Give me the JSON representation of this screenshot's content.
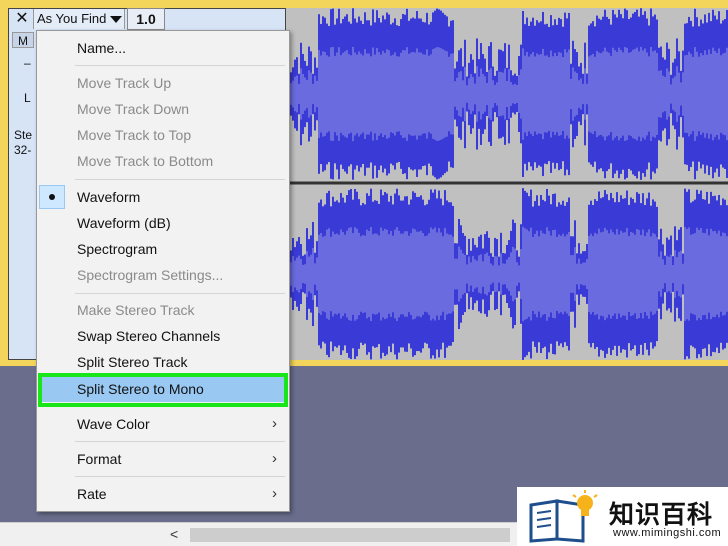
{
  "track": {
    "close_glyph": "✕",
    "name": "As You Find",
    "zoom": "1.0",
    "mute_stub": "M",
    "gain_stub": "–",
    "pan_stub": "L",
    "info_line1": "Ste",
    "info_line2": "32-",
    "waveform_color": "#3a3ad6",
    "waveform_light_color": "#6b6be0",
    "waveform_bg": "#c0c0c0"
  },
  "menu": {
    "items": [
      {
        "label": "Name...",
        "enabled": true
      },
      {
        "label": "Move Track Up",
        "enabled": false
      },
      {
        "label": "Move Track Down",
        "enabled": false
      },
      {
        "label": "Move Track to Top",
        "enabled": false
      },
      {
        "label": "Move Track to Bottom",
        "enabled": false
      },
      {
        "label": "Waveform",
        "enabled": true,
        "checked": true
      },
      {
        "label": "Waveform (dB)",
        "enabled": true
      },
      {
        "label": "Spectrogram",
        "enabled": true
      },
      {
        "label": "Spectrogram Settings...",
        "enabled": false
      },
      {
        "label": "Make Stereo Track",
        "enabled": false
      },
      {
        "label": "Swap Stereo Channels",
        "enabled": true
      },
      {
        "label": "Split Stereo Track",
        "enabled": true
      },
      {
        "label": "Split Stereo to Mono",
        "enabled": true,
        "highlighted": true
      },
      {
        "label": "Wave Color",
        "enabled": true,
        "submenu": true
      },
      {
        "label": "Format",
        "enabled": true,
        "submenu": true
      },
      {
        "label": "Rate",
        "enabled": true,
        "submenu": true
      }
    ],
    "submenu_arrow": "›",
    "highlight_outline_color": "#19e619"
  },
  "scrollbar": {
    "left_arrow": "<"
  },
  "watermark": {
    "title": "知识百科",
    "url": "www.mimingshi.com"
  }
}
